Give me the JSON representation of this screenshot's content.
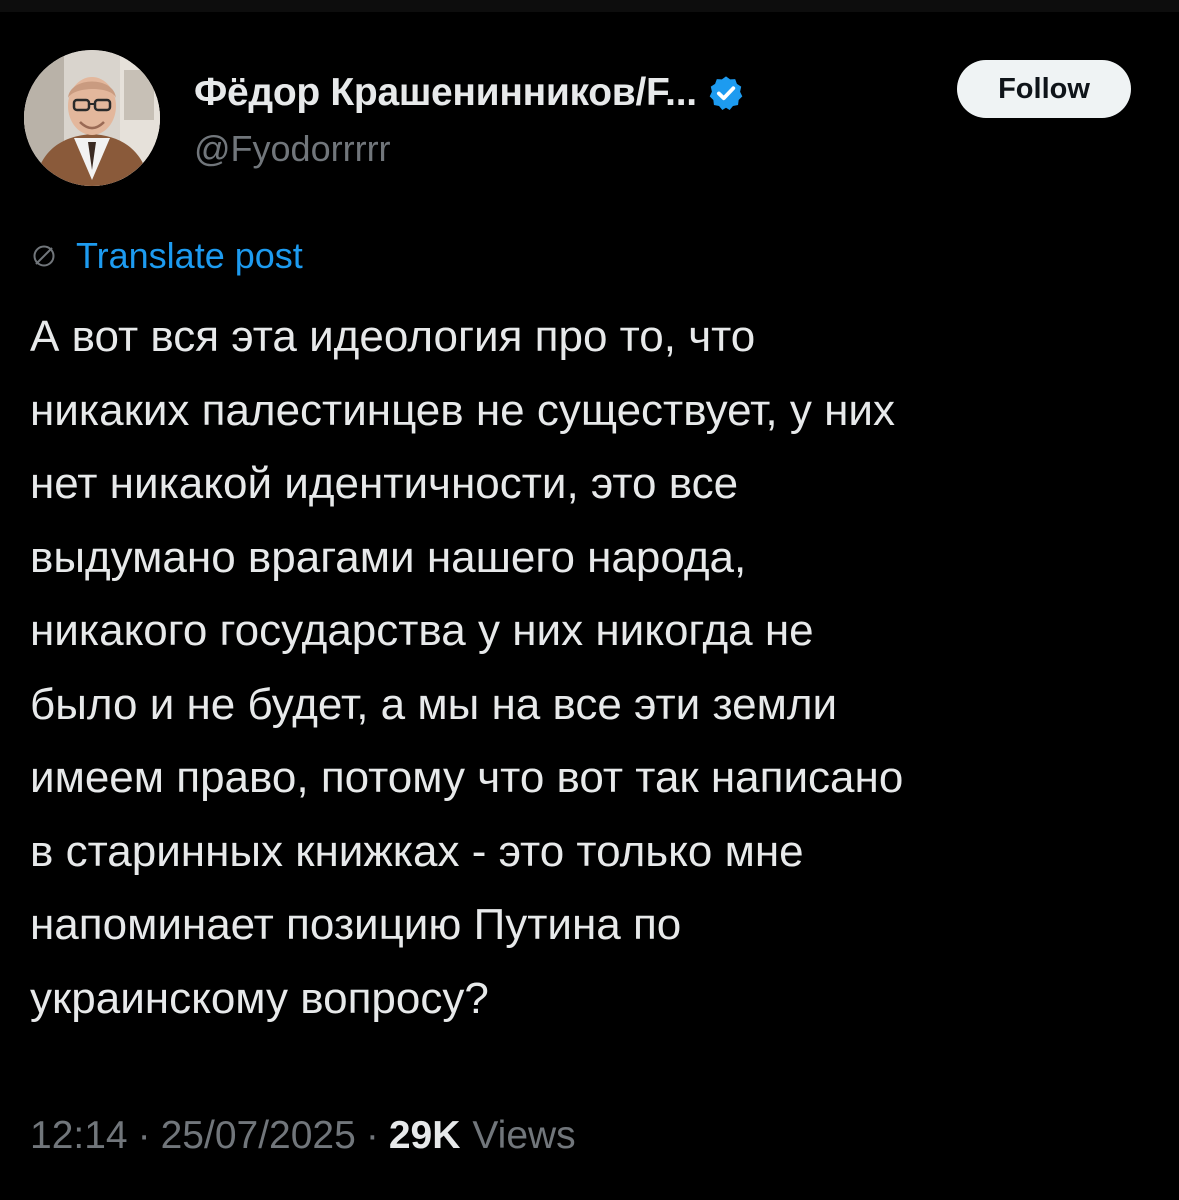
{
  "post": {
    "author": {
      "display_name": "Фёдор Крашенинников/F...",
      "handle": "@Fyodorrrrr",
      "verified_icon": "verified-badge-icon",
      "avatar_icon": "avatar-photo"
    },
    "follow_label": "Follow",
    "translate_label": "Translate post",
    "translate_icon": "globe-icon",
    "text": "А вот вся эта идеология про то, что\nникаких палестинцев не существует, у них\nнет никакой идентичности, это все\nвыдумано врагами нашего народа,\nникакого государства у них никогда не\nбыло и не будет, а мы на все эти земли\nимеем право, потому что вот так написано\nв старинных книжках - это только мне\nнапоминает позицию Путина по\nукраинскому вопросу?",
    "time": "12:14",
    "separator": "·",
    "date": "25/07/2025",
    "views_count": "29K",
    "views_label": "Views"
  },
  "colors": {
    "background": "#000000",
    "text_primary": "#e7e9ea",
    "text_secondary": "#71767b",
    "accent": "#1d9bf0",
    "follow_bg": "#eff3f4"
  }
}
